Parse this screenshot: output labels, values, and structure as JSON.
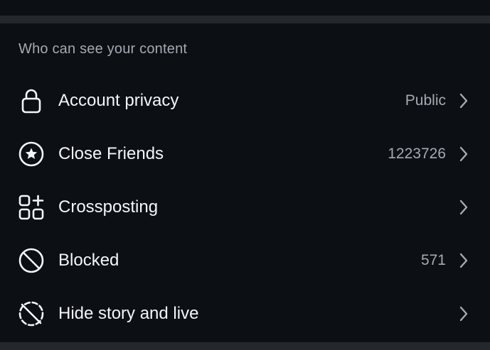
{
  "section": {
    "title": "Who can see your content"
  },
  "rows": [
    {
      "label": "Account privacy",
      "value": "Public",
      "icon": "lock-icon"
    },
    {
      "label": "Close Friends",
      "value": "1223726",
      "icon": "star-circle-icon"
    },
    {
      "label": "Crossposting",
      "value": "",
      "icon": "grid-plus-icon"
    },
    {
      "label": "Blocked",
      "value": "571",
      "icon": "block-icon"
    },
    {
      "label": "Hide story and live",
      "value": "",
      "icon": "story-off-icon"
    }
  ],
  "colors": {
    "background": "#0c0f14",
    "divider": "#24272c",
    "text": "#f5f6f8",
    "muted": "#a6aab3"
  }
}
